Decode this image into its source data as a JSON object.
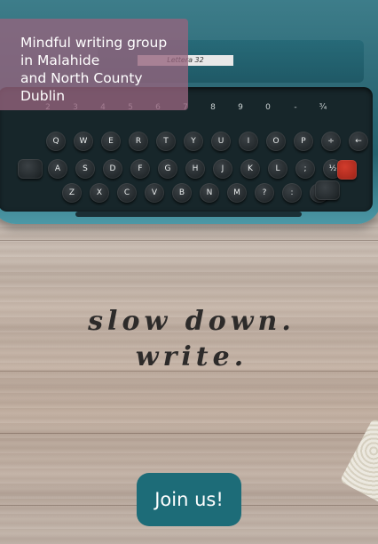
{
  "hero": {
    "info_text": "Mindful writing group\nin Malahide\nand North County\nDublin",
    "slogan_line1": "slow down.",
    "slogan_line2": "write.",
    "typewriter_brand": "Lettera 32"
  },
  "typewriter": {
    "number_row": [
      "2",
      "3",
      "4",
      "5",
      "6",
      "7",
      "8",
      "9",
      "0",
      "-",
      "¾"
    ],
    "row1": [
      "Q",
      "W",
      "E",
      "R",
      "T",
      "Y",
      "U",
      "I",
      "O",
      "P",
      "÷",
      "←"
    ],
    "row2": [
      "A",
      "S",
      "D",
      "F",
      "G",
      "H",
      "J",
      "K",
      "L",
      ";",
      "½"
    ],
    "row3": [
      "Z",
      "X",
      "C",
      "V",
      "B",
      "N",
      "M",
      "?",
      ":",
      "%"
    ]
  },
  "cta": {
    "join_label": "Join us!"
  },
  "colors": {
    "button_bg": "#1d6c78",
    "overlay_bg": "#96647d",
    "typewriter_teal": "#2e6a77"
  }
}
